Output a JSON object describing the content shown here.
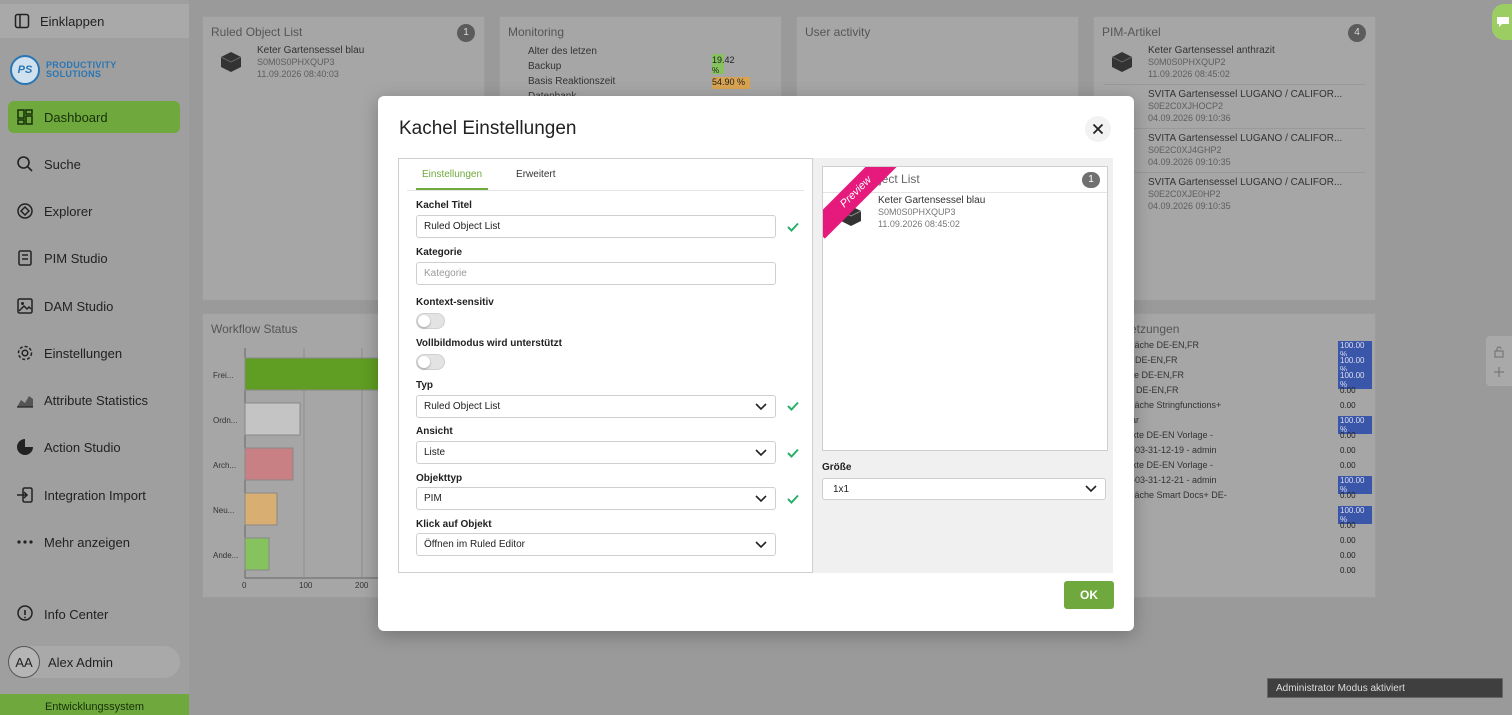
{
  "sidebar": {
    "collapse_label": "Einklappen",
    "logo_initials": "PS",
    "logo_line1": "PRODUCTIVITY",
    "logo_line2": "SOLUTIONS",
    "items": [
      {
        "label": "Dashboard",
        "icon": "dashboard-icon"
      },
      {
        "label": "Suche",
        "icon": "search-icon"
      },
      {
        "label": "Explorer",
        "icon": "explorer-icon"
      },
      {
        "label": "PIM Studio",
        "icon": "pim-studio-icon"
      },
      {
        "label": "DAM Studio",
        "icon": "image-icon"
      },
      {
        "label": "Einstellungen",
        "icon": "gear-icon"
      },
      {
        "label": "Attribute Statistics",
        "icon": "chart-icon"
      },
      {
        "label": "Action Studio",
        "icon": "action-icon"
      },
      {
        "label": "Integration Import",
        "icon": "import-icon"
      },
      {
        "label": "Mehr anzeigen",
        "icon": "more-icon"
      }
    ],
    "info_center": "Info Center",
    "user_initials": "AA",
    "user_name": "Alex Admin",
    "environment": "Entwicklungssystem"
  },
  "tiles": {
    "ruled_list": {
      "title": "Ruled Object List",
      "badge": "1",
      "item": {
        "name": "Keter Gartensessel blau",
        "code": "S0M0S0PHXQUP3",
        "date": "11.09.2026 08:40:03"
      }
    },
    "monitoring": {
      "title": "Monitoring",
      "rows": [
        "Alter des letzen",
        "Backup",
        "Basis Reaktionszeit",
        "Datenbank"
      ],
      "value1": "19.42",
      "value1_unit": "%",
      "value2": "54.90 %"
    },
    "user_activity": {
      "title": "User activity"
    },
    "pim_articles": {
      "title": "PIM-Artikel",
      "badge": "4",
      "items": [
        {
          "name": "Keter Gartensessel anthrazit",
          "code": "S0M0S0PHXQUP2",
          "date": "11.09.2026 08:45:02"
        },
        {
          "name": "SVITA Gartensessel LUGANO / CALIFOR...",
          "code": "S0E2C0XJHOCP2",
          "date": "04.09.2026 09:10:36"
        },
        {
          "name": "SVITA Gartensessel LUGANO / CALIFOR...",
          "code": "S0E2C0XJ4GHP2",
          "date": "04.09.2026 09:10:35"
        },
        {
          "name": "SVITA Gartensessel LUGANO / CALIFOR...",
          "code": "S0E2C0XJE0HP2",
          "date": "04.09.2026 09:10:35"
        }
      ]
    },
    "workflow": {
      "title": "Workflow Status",
      "categories": [
        "Frei...",
        "Ordn...",
        "Arch...",
        "Neu...",
        "Ande..."
      ],
      "ticks": [
        "0",
        "100",
        "200"
      ],
      "colors": [
        "#5f9e22",
        "#c4c4c4",
        "#c88084",
        "#d9ae72",
        "#86c25e"
      ]
    },
    "translations": {
      "title": "etzungen",
      "rows": [
        {
          "label": "erfläche DE-EN,FR",
          "value": "100.00 %"
        },
        {
          "label": "rte DE-EN,FR",
          "value": "100.00 %"
        },
        {
          "label": "näle DE-EN,FR",
          "value": "100.00 %"
        },
        {
          "label": "ise DE-EN,FR",
          "value": "0.00"
        },
        {
          "label": "erfläche Stringfunctions+",
          "value": "0.00"
        },
        {
          "label": "ssar",
          "value": "100.00 %"
        },
        {
          "label": "dukte DE-EN Vorlage -",
          "value": "0.00"
        },
        {
          "label": "26-03-31-12-19 - admin",
          "value": "0.00"
        },
        {
          "label": "dukte DE-EN Vorlage -",
          "value": "0.00"
        },
        {
          "label": "26-03-31-12-21 - admin",
          "value": "100.00 %"
        },
        {
          "label": "erfläche Smart Docs+ DE-",
          "value": "0.00"
        },
        {
          "label": "FR",
          "value": "100.00 %"
        },
        {
          "label": "",
          "value": "0.00"
        },
        {
          "label": "",
          "value": "0.00"
        },
        {
          "label": "",
          "value": "0.00"
        },
        {
          "label": "",
          "value": "0.00"
        }
      ]
    }
  },
  "modal": {
    "title": "Kachel Einstellungen",
    "tabs": [
      "Einstellungen",
      "Erweitert"
    ],
    "fields": {
      "title_label": "Kachel Titel",
      "title_value": "Ruled Object List",
      "category_label": "Kategorie",
      "category_placeholder": "Kategorie",
      "context_label": "Kontext-sensitiv",
      "fullscreen_label": "Vollbildmodus wird unterstützt",
      "type_label": "Typ",
      "type_value": "Ruled Object List",
      "view_label": "Ansicht",
      "view_value": "Liste",
      "objtype_label": "Objekttyp",
      "objtype_value": "PIM",
      "click_label": "Klick auf Objekt",
      "click_value": "Öffnen im Ruled Editor"
    },
    "preview": {
      "ribbon": "Preview",
      "title": "Object List",
      "badge": "1",
      "item": {
        "name": "Keter Gartensessel blau",
        "code": "S0M0S0PHXQUP3",
        "date": "11.09.2026 08:45:02"
      }
    },
    "size_label": "Größe",
    "size_value": "1x1",
    "ok_label": "OK"
  },
  "admin_toast": "Administrator Modus aktiviert",
  "colors": {
    "accent": "#6fa83c",
    "ribbon": "#e6197d",
    "logo": "#2a76b5"
  }
}
